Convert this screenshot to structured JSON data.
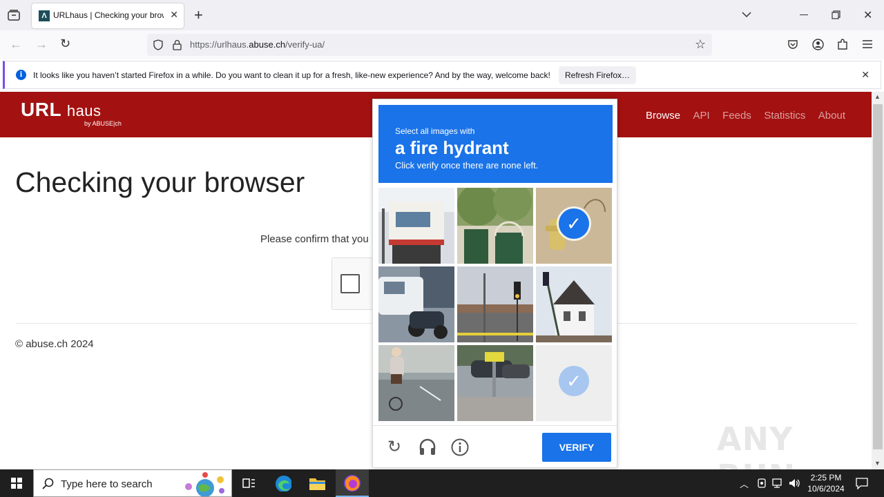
{
  "browser": {
    "tab_title": "URLhaus | Checking your browser",
    "url_prefix": "https://urlhaus.",
    "url_domain": "abuse.ch",
    "url_path": "/verify-ua/"
  },
  "notification": {
    "message": "It looks like you haven’t started Firefox in a while. Do you want to clean it up for a fresh, like-new experience? And by the way, welcome back!",
    "button": "Refresh Firefox…"
  },
  "site": {
    "logo_url": "URL",
    "logo_haus": "haus",
    "logo_by": "by ABUSE|ch",
    "nav": [
      {
        "label": "Browse",
        "active": true
      },
      {
        "label": "API",
        "active": false
      },
      {
        "label": "Feeds",
        "active": false
      },
      {
        "label": "Statistics",
        "active": false
      },
      {
        "label": "About",
        "active": false
      }
    ],
    "heading": "Checking your browser",
    "confirm_text": "Please confirm that you",
    "footer": "© abuse.ch 2024",
    "watermark": "ANY RUN"
  },
  "captcha": {
    "line1": "Select all images with",
    "target": "a fire hydrant",
    "line3": "Click verify once there are none left.",
    "verify_label": "VERIFY",
    "tiles": [
      {
        "name": "street-storefront",
        "selected": false,
        "faded": false
      },
      {
        "name": "green-gate",
        "selected": false,
        "faded": false
      },
      {
        "name": "hydrant-dry-grass",
        "selected": true,
        "faded": false
      },
      {
        "name": "van-scooter",
        "selected": false,
        "faded": false
      },
      {
        "name": "traffic-light-intersection",
        "selected": false,
        "faded": false
      },
      {
        "name": "white-house-traffic-light",
        "selected": false,
        "faded": false
      },
      {
        "name": "cyclist-street",
        "selected": false,
        "faded": false
      },
      {
        "name": "street-sign-cars",
        "selected": false,
        "faded": false
      },
      {
        "name": "fading-selected-tile",
        "selected": true,
        "faded": true
      }
    ]
  },
  "taskbar": {
    "search_placeholder": "Type here to search",
    "time": "2:25 PM",
    "date": "10/6/2024"
  },
  "colors": {
    "header_red": "#a31111",
    "captcha_blue": "#1a73e8"
  }
}
